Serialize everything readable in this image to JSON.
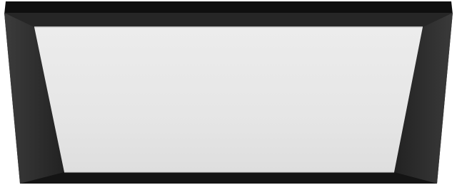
{
  "product": {
    "subject": "square-led-ceiling-panel",
    "frame_color": "#1e1e1e",
    "frame_edge_highlight": "#4a4a4a",
    "diffuser_color": "#e9e9e9",
    "background_color": "#ffffff"
  }
}
